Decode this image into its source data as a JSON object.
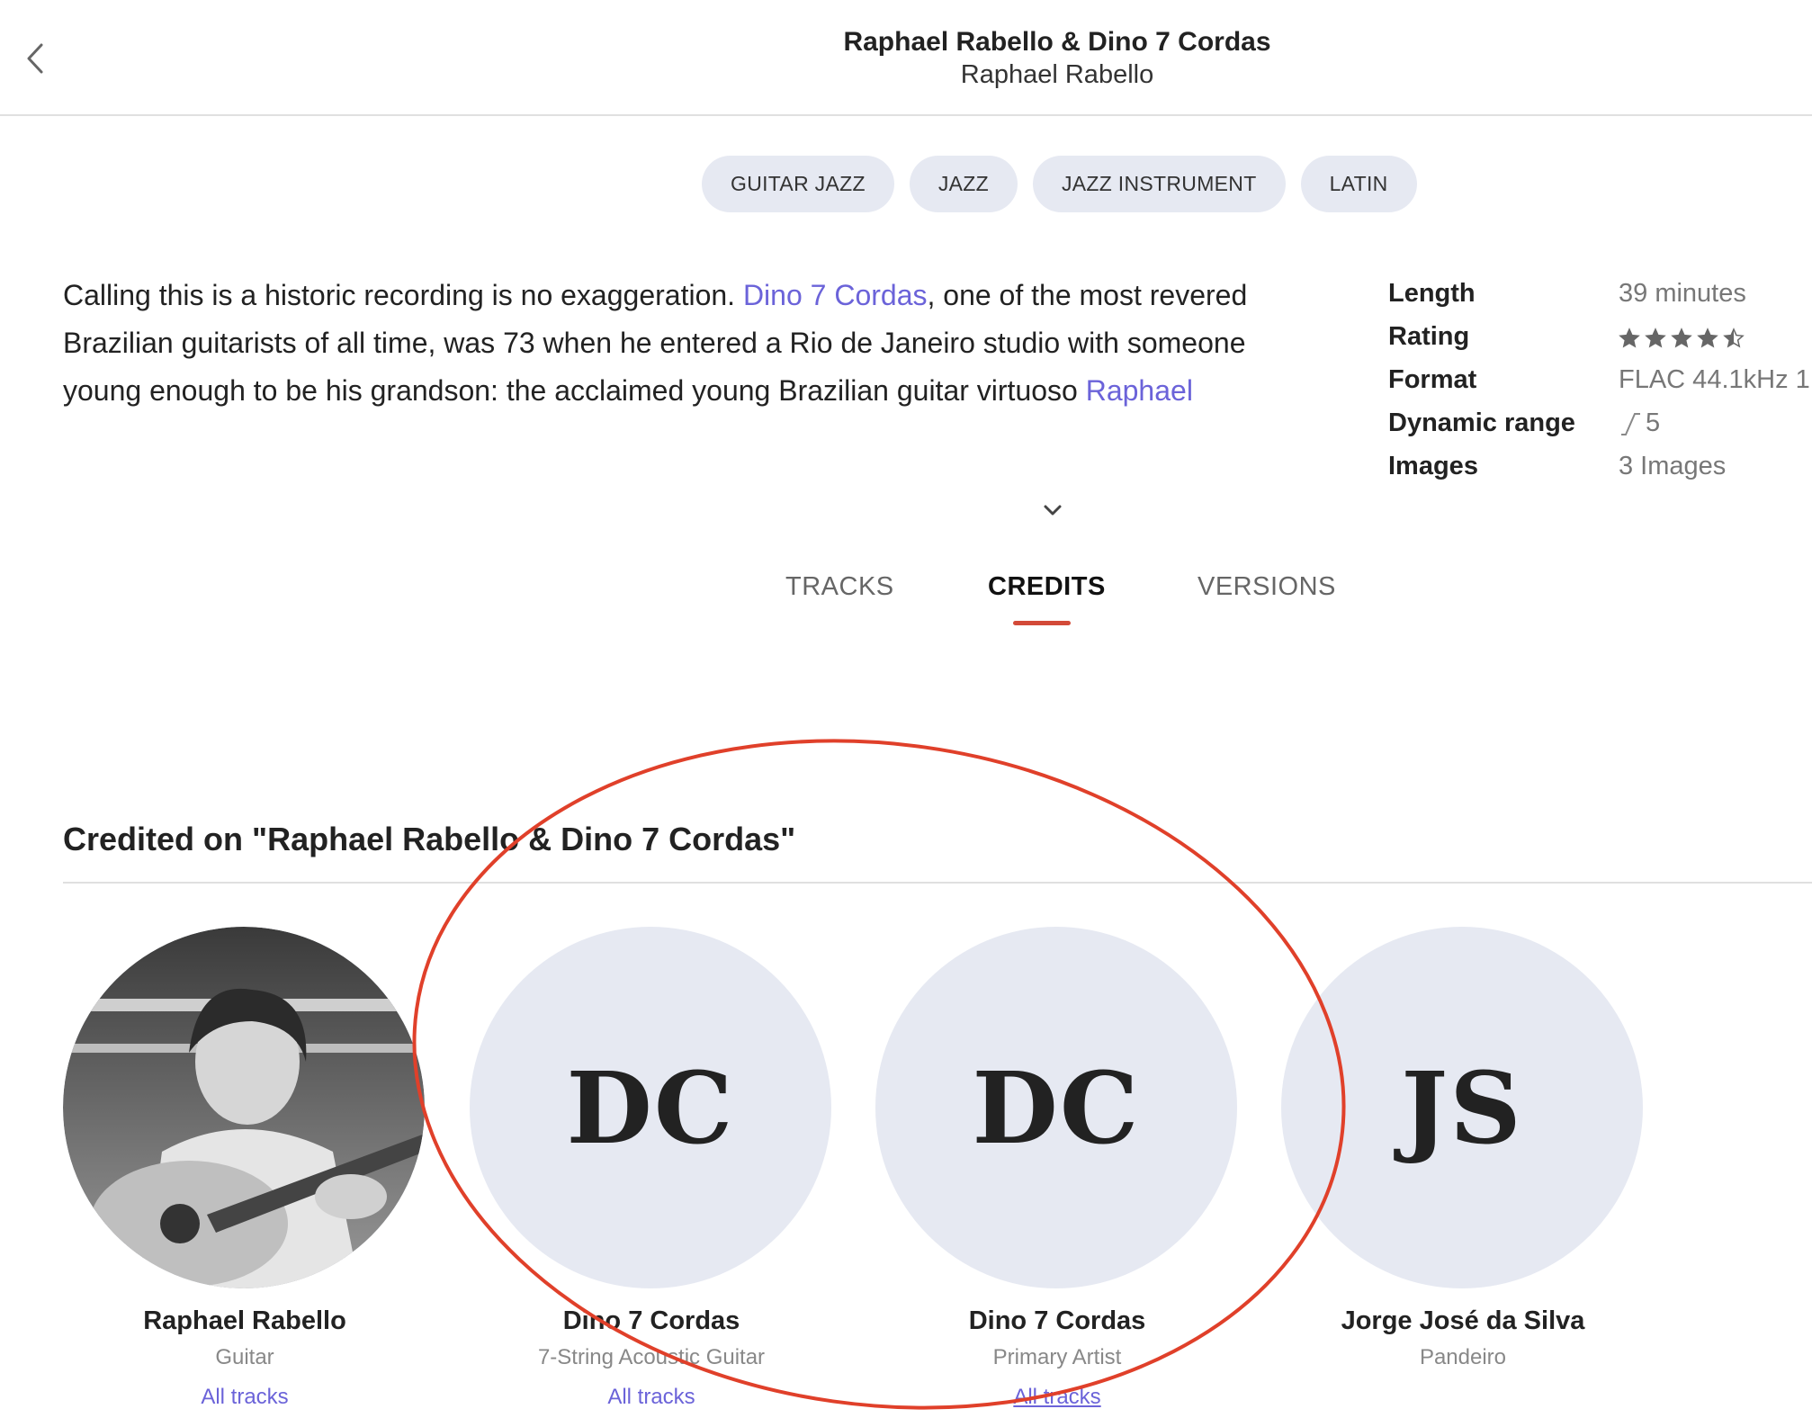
{
  "header": {
    "title": "Raphael Rabello & Dino 7 Cordas",
    "subtitle": "Raphael Rabello"
  },
  "genres": [
    "GUITAR JAZZ",
    "JAZZ",
    "JAZZ INSTRUMENT",
    "LATIN"
  ],
  "description": {
    "part1": "Calling this is a historic recording is no exaggeration. ",
    "link1": "Dino 7 Cordas",
    "part2": ", one of the most revered Brazilian guitarists of all time, was 73 when he entered a Rio de Janeiro studio with someone young enough to be his grandson: the acclaimed young Brazilian guitar virtuoso ",
    "link2": "Raphael"
  },
  "meta": {
    "length_label": "Length",
    "length_value": "39 minutes",
    "rating_label": "Rating",
    "rating_value": 4.5,
    "format_label": "Format",
    "format_value": "FLAC 44.1kHz 1",
    "dr_label": "Dynamic range",
    "dr_value": "5",
    "images_label": "Images",
    "images_value": "3 Images"
  },
  "tabs": [
    {
      "label": "TRACKS",
      "active": false
    },
    {
      "label": "CREDITS",
      "active": true
    },
    {
      "label": "VERSIONS",
      "active": false
    }
  ],
  "credits_title": "Credited on \"Raphael Rabello & Dino 7 Cordas\"",
  "credits": [
    {
      "name": "Raphael Rabello",
      "role": "Guitar",
      "link": "All tracks",
      "avatar": "photo"
    },
    {
      "name": "Dino 7 Cordas",
      "role": "7-String Acoustic Guitar",
      "link": "All tracks",
      "initials": "DC"
    },
    {
      "name": "Dino 7 Cordas",
      "role": "Primary Artist",
      "link": "All tracks",
      "initials": "DC"
    },
    {
      "name": "Jorge José da Silva",
      "role": "Pandeiro",
      "initials": "JS"
    }
  ],
  "colors": {
    "accent_link": "#6b63d9",
    "tab_underline": "#d34a38",
    "chip_bg": "#e6e9f2",
    "annotation": "#e0402a"
  },
  "icons": {
    "back": "chevron-left-icon",
    "expand": "chevron-down-icon",
    "rating": "star-icon",
    "dynamic_range": "dynamic-range-icon"
  }
}
